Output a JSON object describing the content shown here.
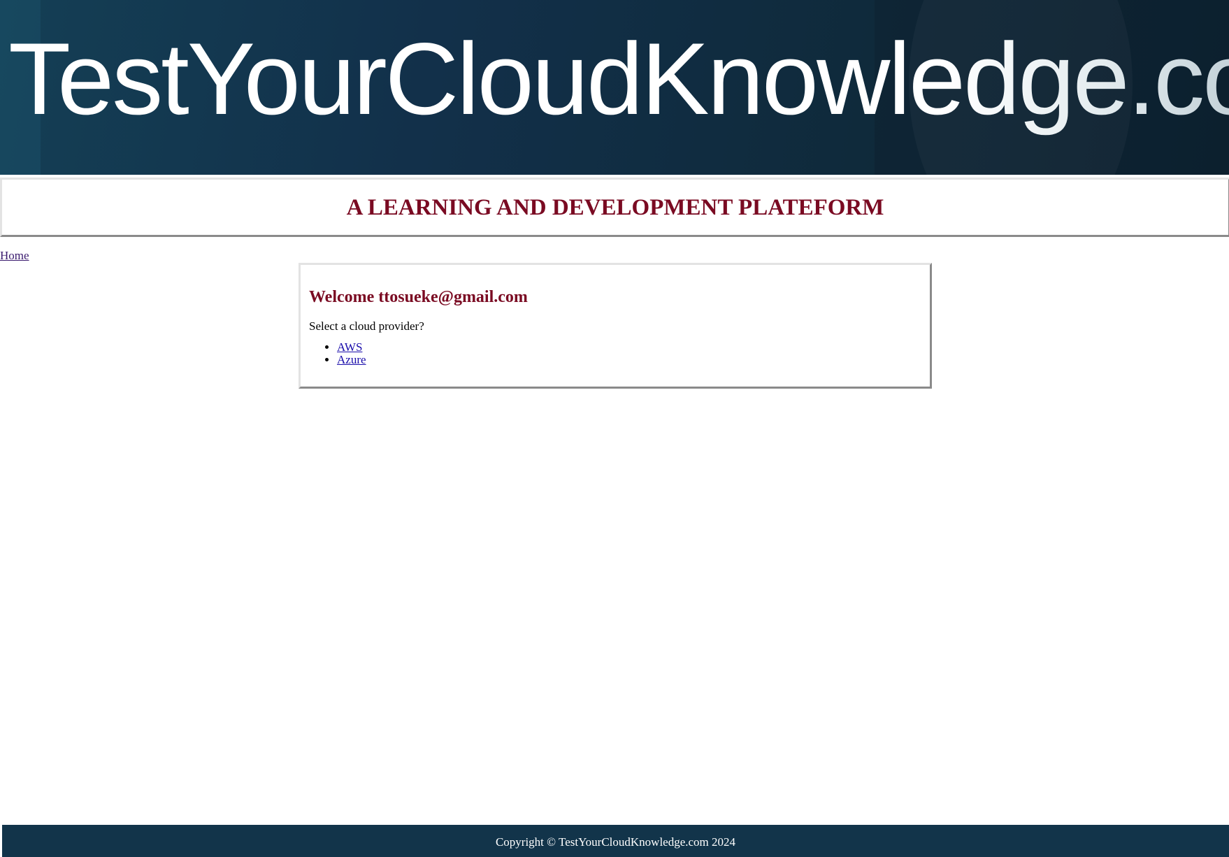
{
  "banner": {
    "site_title": "TestYourCloudKnowledge.com"
  },
  "tagline": "A LEARNING AND DEVELOPMENT PLATEFORM",
  "nav": {
    "home_label": "Home"
  },
  "welcome": {
    "title": "Welcome ttosueke@gmail.com",
    "prompt": "Select a cloud provider?",
    "providers": [
      {
        "label": "AWS"
      },
      {
        "label": "Azure"
      }
    ]
  },
  "footer": {
    "copyright": "Copyright © TestYourCloudKnowledge.com 2024"
  },
  "colors": {
    "banner_bg": "#12304a",
    "accent_maroon": "#7a0a22",
    "link_blue": "#1a0dab",
    "visited_link": "#3a1a6e",
    "footer_bg": "#12344a"
  }
}
